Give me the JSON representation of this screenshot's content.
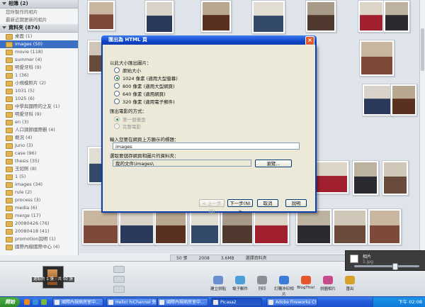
{
  "sidebar": {
    "sections": [
      {
        "label": "相簿 (2)",
        "children": [
          "您所製作的相片",
          "最新近期更新的相片"
        ]
      },
      {
        "label": "資料夾 (874)"
      }
    ],
    "folders": [
      {
        "label": "桌面 (1)"
      },
      {
        "label": "images (50)",
        "selected": true
      },
      {
        "label": "movie (118)"
      },
      {
        "label": "summer (4)"
      },
      {
        "label": "明愛牙科 (9)"
      },
      {
        "label": "1 (36)"
      },
      {
        "label": "小規模照片 (2)"
      },
      {
        "label": "1031 (5)"
      },
      {
        "label": "1025 (6)"
      },
      {
        "label": "中學與國際的之友 (1)"
      },
      {
        "label": "明愛牙科 (9)"
      },
      {
        "label": "en (3)"
      },
      {
        "label": "人口調節國際觀 (4)"
      },
      {
        "label": "概況 (4)"
      },
      {
        "label": "Juno (3)"
      },
      {
        "label": "case (96)"
      },
      {
        "label": "thesis (35)"
      },
      {
        "label": "玉如照 (8)"
      },
      {
        "label": "1 (5)"
      },
      {
        "label": "images (34)"
      },
      {
        "label": "rule (2)"
      },
      {
        "label": "process (3)"
      },
      {
        "label": "media (6)"
      },
      {
        "label": "merge (17)"
      },
      {
        "label": "20080426 (76)"
      },
      {
        "label": "20080418 (41)"
      },
      {
        "label": "promotion說明 (1)"
      },
      {
        "label": "國際內線國際中心 (4)"
      }
    ]
  },
  "status_strip": [
    "50 張",
    "2008",
    "3.6MB",
    "選擇資料夾"
  ],
  "dialog": {
    "title": "匯出為 HTML 頁",
    "size_label": "以此大小匯出圖片：",
    "size_options": [
      {
        "label": "原始大小",
        "checked": false
      },
      {
        "label": "1024 像素 (適用大型螢幕)",
        "checked": true
      },
      {
        "label": "800 像素 (適用大型網頁)",
        "checked": false
      },
      {
        "label": "640 像素 (適用網頁)",
        "checked": false
      },
      {
        "label": "320 像素 (適用電子郵件)",
        "checked": false
      }
    ],
    "method_label": "匯出電影的方式：",
    "method_options": [
      {
        "label": "第一個畫面",
        "checked": true
      },
      {
        "label": "完整電影",
        "checked": false
      }
    ],
    "title_prompt": "輸入您要在網頁上方顯示的標題：",
    "title_value": "images",
    "folder_prompt": "選取要儲存網頁和圖片的資料夾：",
    "folder_value": "我的文件\\images\\",
    "browse_button": "瀏覽...",
    "buttons": {
      "back": "< 上一步(B)",
      "next": "下一步(N) >",
      "cancel": "取消",
      "help": "說明"
    }
  },
  "tray": {
    "thumb_label": "選取的 1 張 - 共 50 張",
    "tools": [
      "建立拼貼",
      "電子郵件",
      "列印",
      "訂購沖印相片",
      "BlogThis!",
      "拼圖相片",
      "匯出"
    ],
    "notify_title": "相片",
    "notify_sub": "1.jpg"
  },
  "taskbar": {
    "start": "開始",
    "tasks": [
      {
        "label": "國際內視病房室中...",
        "active": false
      },
      {
        "label": "Hello! hiChannel 免費...",
        "active": false
      },
      {
        "label": "國際內視病房室中...",
        "active": false
      },
      {
        "label": "Picasa2",
        "active": true
      },
      {
        "label": "Adobe Fireworks CS3 ...",
        "active": false
      }
    ],
    "clock": "下午 02:08"
  },
  "colors": {
    "selection": "#3b6fc5",
    "title_bar": "#1047cc",
    "taskbar": "#245ddb",
    "start": "#2f8a2a"
  }
}
